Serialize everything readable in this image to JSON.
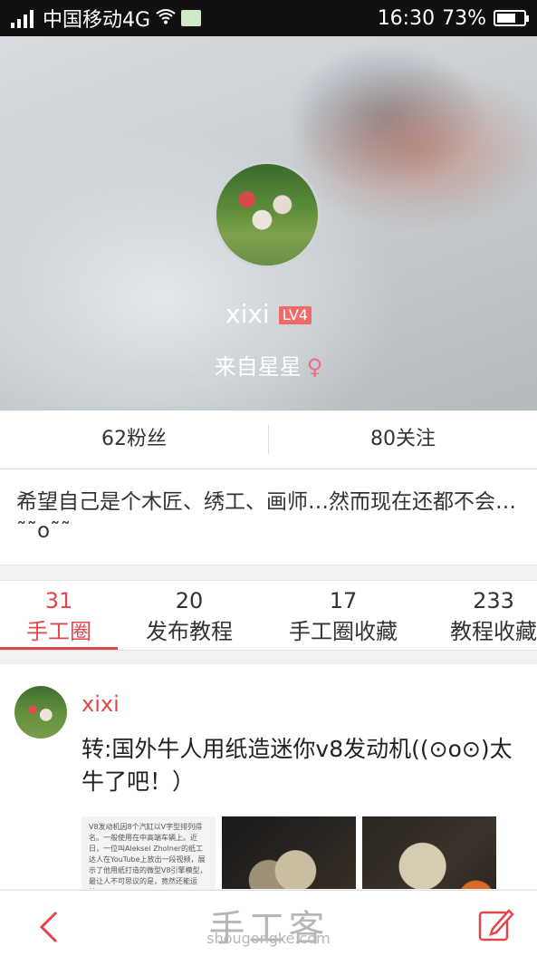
{
  "status_bar": {
    "carrier": "中国移动4G",
    "time": "16:30",
    "battery": "73%",
    "battery_level": 0.73
  },
  "profile": {
    "username": "xixi",
    "level_badge": "LV4",
    "location": "来自星星",
    "gender_symbol": "♀"
  },
  "stats": {
    "fans": "62粉丝",
    "following": "80关注"
  },
  "bio": "希望自己是个木匠、绣工、画师…然而现在还都不会…˜˜o˜˜",
  "tabs": [
    {
      "count": "31",
      "label": "手工圈",
      "active": true
    },
    {
      "count": "20",
      "label": "发布教程",
      "active": false
    },
    {
      "count": "17",
      "label": "手工圈收藏",
      "active": false
    },
    {
      "count": "233",
      "label": "教程收藏",
      "active": false
    }
  ],
  "post": {
    "author": "xixi",
    "title": "转:国外牛人用纸造迷你v8发动机((⊙o⊙)太牛了吧！）",
    "thumb_text": "V8发动机因8个汽缸以V字型排列得名。一般使用在中高端车辆上。近日，一位叫Aleksei Zholner的纸工达人在YouTube上放出一段视频，展示了他用纸打造的微型V8引擎模型，最让人不可思议的是，竟然还能运转。"
  },
  "watermark": {
    "main": "手工客",
    "sub": "shougongke.com"
  },
  "colors": {
    "accent": "#e0474c",
    "status_bar": "#111111"
  },
  "icons": {
    "back": "chevron-left-icon",
    "edit": "edit-icon"
  }
}
